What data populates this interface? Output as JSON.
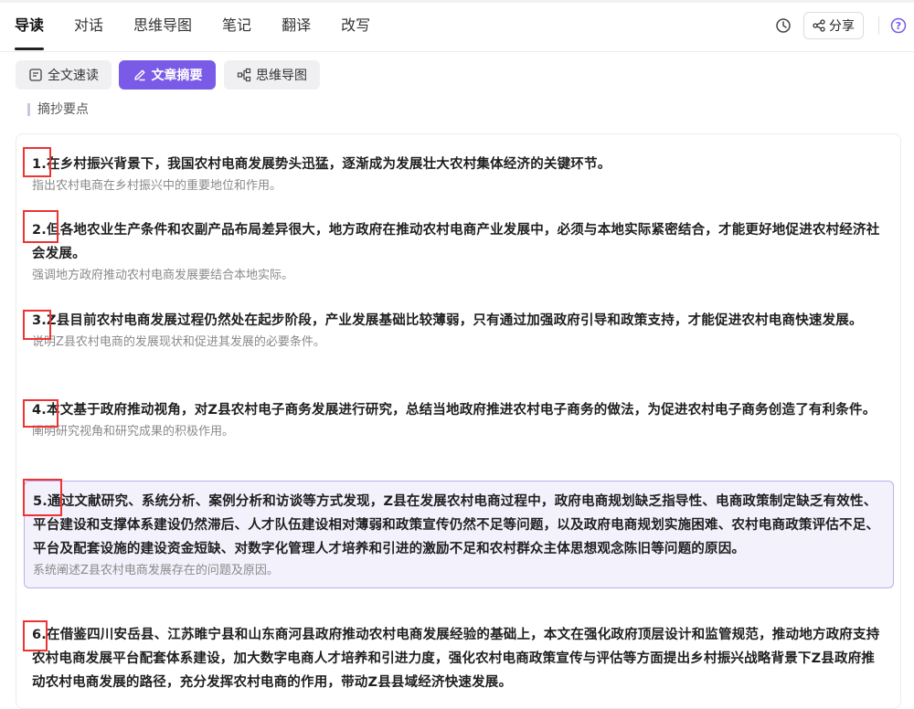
{
  "tabs": [
    "导读",
    "对话",
    "思维导图",
    "笔记",
    "翻译",
    "改写"
  ],
  "header": {
    "share_label": "分享"
  },
  "toolbar": {
    "fulltext_label": "全文速读",
    "summary_label": "文章摘要",
    "mindmap_label": "思维导图"
  },
  "section_label": "摘抄要点",
  "items": [
    {
      "main": "1.在乡村振兴背景下，我国农村电商发展势头迅猛，逐渐成为发展壮大农村集体经济的关键环节。",
      "sub": "指出农村电商在乡村振兴中的重要地位和作用。"
    },
    {
      "main": "2.但各地农业生产条件和农副产品布局差异很大，地方政府在推动农村电商产业发展中，必须与本地实际紧密结合，才能更好地促进农村经济社会发展。",
      "sub": "强调地方政府推动农村电商发展要结合本地实际。"
    },
    {
      "main": "3.Z县目前农村电商发展过程仍然处在起步阶段，产业发展基础比较薄弱，只有通过加强政府引导和政策支持，才能促进农村电商快速发展。",
      "sub": "说明Z县农村电商的发展现状和促进其发展的必要条件。"
    },
    {
      "main": "4.本文基于政府推动视角，对Z县农村电子商务发展进行研究，总结当地政府推进农村电子商务的做法，为促进农村电子商务创造了有利条件。",
      "sub": "阐明研究视角和研究成果的积极作用。"
    },
    {
      "main": "5.通过文献研究、系统分析、案例分析和访谈等方式发现，Z县在发展农村电商过程中，政府电商规划缺乏指导性、电商政策制定缺乏有效性、平台建设和支撑体系建设仍然滞后、人才队伍建设相对薄弱和政策宣传仍然不足等问题，以及政府电商规划实施困难、农村电商政策评估不足、平台及配套设施的建设资金短缺、对数字化管理人才培养和引进的激励不足和农村群众主体思想观念陈旧等问题的原因。",
      "sub": "系统阐述Z县农村电商发展存在的问题及原因。"
    },
    {
      "main": "6.在借鉴四川安岳县、江苏睢宁县和山东商河县政府推动农村电商发展经验的基础上，本文在强化政府顶层设计和监管规范，推动地方政府支持农村电商发展平台配套体系建设，加大数字电商人才培养和引进力度，强化农村电商政策宣传与评估等方面提出乡村振兴战略背景下Z县政府推动农村电商发展的路径，充分发挥农村电商的作用，带动Z县县域经济快速发展。",
      "sub": ""
    }
  ],
  "colors": {
    "accent": "#7a5be8",
    "highlight_bg": "#f3f1fc",
    "highlight_border": "#b9b0ec",
    "annotation": "#ee3333"
  },
  "icons": [
    "clock-icon",
    "share-icon",
    "help-icon",
    "fulltext-icon",
    "edit-icon",
    "mindmap-icon"
  ]
}
